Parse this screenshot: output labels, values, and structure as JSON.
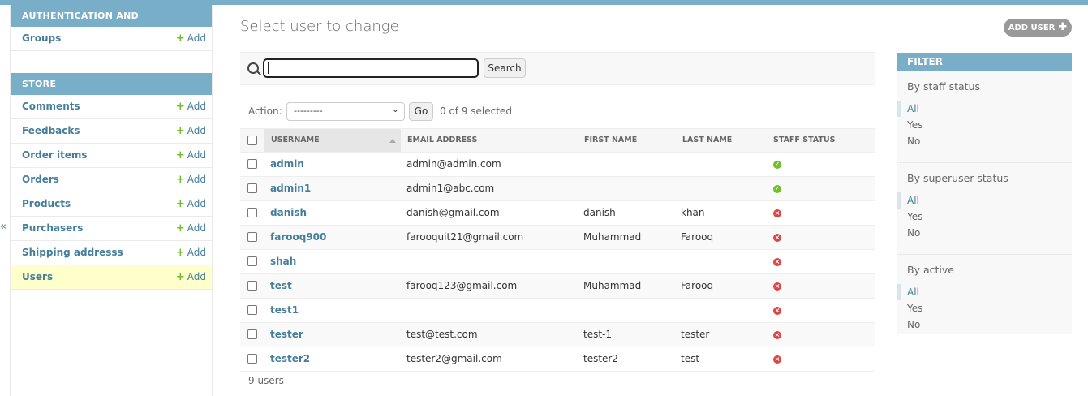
{
  "colors": {
    "accent": "#79aec8",
    "link": "#447e9b",
    "add_green": "#70bf2b",
    "current_row": "#ffffcc",
    "status_yes": "#70bf2b",
    "status_no": "#dd4646"
  },
  "sidebar": {
    "collapse_glyph": "«",
    "apps": [
      {
        "caption": "AUTHENTICATION AND AUTHORIZATION",
        "models": [
          {
            "name": "Groups",
            "add": "Add"
          }
        ]
      },
      {
        "caption": "STORE",
        "models": [
          {
            "name": "Comments",
            "add": "Add"
          },
          {
            "name": "Feedbacks",
            "add": "Add"
          },
          {
            "name": "Order items",
            "add": "Add"
          },
          {
            "name": "Orders",
            "add": "Add"
          },
          {
            "name": "Products",
            "add": "Add"
          },
          {
            "name": "Purchasers",
            "add": "Add"
          },
          {
            "name": "Shipping addresss",
            "add": "Add"
          },
          {
            "name": "Users",
            "add": "Add"
          }
        ]
      }
    ]
  },
  "main": {
    "title": "Select user to change",
    "add_user_label": "ADD USER",
    "search": {
      "icon": "search-icon",
      "value": "",
      "button": "Search"
    },
    "actions": {
      "label": "Action:",
      "selected_option": "---------",
      "go": "Go",
      "selected_count": "0 of 9 selected"
    },
    "columns": [
      "USERNAME",
      "EMAIL ADDRESS",
      "FIRST NAME",
      "LAST NAME",
      "STAFF STATUS"
    ],
    "rows": [
      {
        "username": "admin",
        "email": "admin@admin.com",
        "first": "",
        "last": "",
        "staff": true
      },
      {
        "username": "admin1",
        "email": "admin1@abc.com",
        "first": "",
        "last": "",
        "staff": true
      },
      {
        "username": "danish",
        "email": "danish@gmail.com",
        "first": "danish",
        "last": "khan",
        "staff": false
      },
      {
        "username": "farooq900",
        "email": "farooquit21@gmail.com",
        "first": "Muhammad",
        "last": "Farooq",
        "staff": false
      },
      {
        "username": "shah",
        "email": "",
        "first": "",
        "last": "",
        "staff": false
      },
      {
        "username": "test",
        "email": "farooq123@gmail.com",
        "first": "Muhammad",
        "last": "Farooq",
        "staff": false
      },
      {
        "username": "test1",
        "email": "",
        "first": "",
        "last": "",
        "staff": false
      },
      {
        "username": "tester",
        "email": "test@test.com",
        "first": "test-1",
        "last": "tester",
        "staff": false
      },
      {
        "username": "tester2",
        "email": "tester2@gmail.com",
        "first": "tester2",
        "last": "test",
        "staff": false
      }
    ],
    "paginator": "9 users"
  },
  "filter": {
    "title": "FILTER",
    "groups": [
      {
        "title": "By staff status",
        "options": [
          "All",
          "Yes",
          "No"
        ],
        "selected": "All"
      },
      {
        "title": "By superuser status",
        "options": [
          "All",
          "Yes",
          "No"
        ],
        "selected": "All"
      },
      {
        "title": "By active",
        "options": [
          "All",
          "Yes",
          "No"
        ],
        "selected": "All"
      }
    ]
  }
}
